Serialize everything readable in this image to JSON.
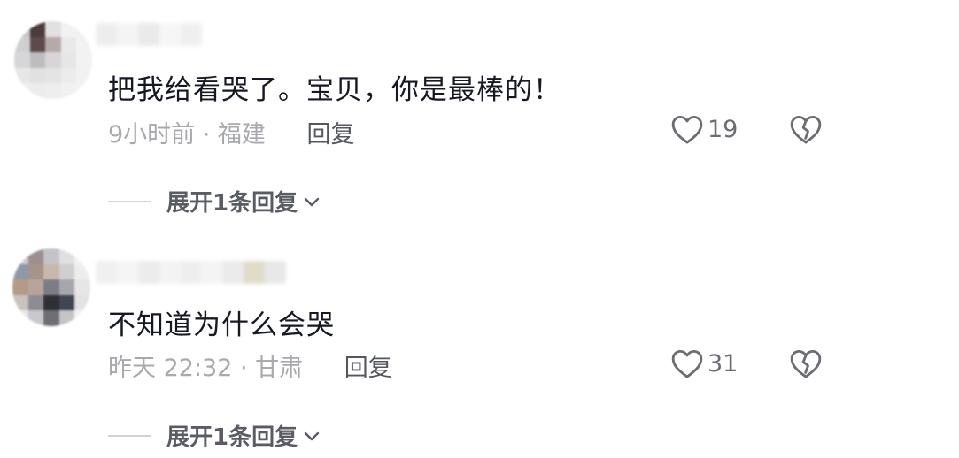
{
  "comments": [
    {
      "text": "把我给看哭了。宝贝，你是最棒的！",
      "meta": "9小时前 · 福建",
      "reply_label": "回复",
      "likes": "19",
      "expand_label": "展开1条回复"
    },
    {
      "text": "不知道为什么会哭",
      "meta": "昨天 22:32 · 甘肃",
      "reply_label": "回复",
      "likes": "31",
      "expand_label": "展开1条回复"
    }
  ],
  "colors": {
    "text": "#161823",
    "meta": "#a7a9ad",
    "reply": "#55575e",
    "icon": "#6b6d73"
  }
}
